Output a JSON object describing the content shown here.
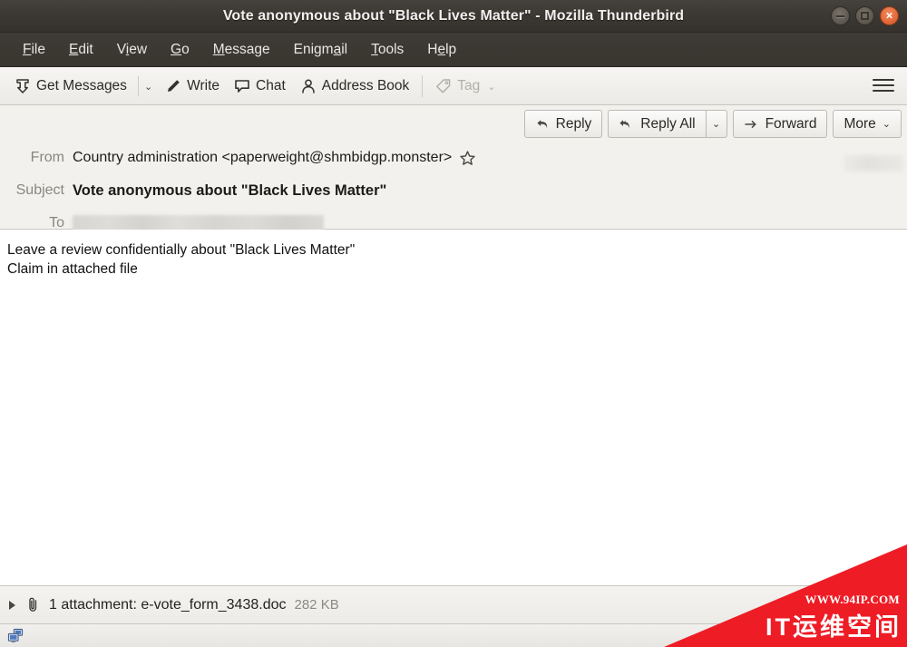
{
  "window": {
    "title": "Vote anonymous about \"Black Lives Matter\" - Mozilla Thunderbird",
    "controls": {
      "minimize": "minimize",
      "maximize": "maximize",
      "close": "×"
    }
  },
  "menubar": {
    "items": [
      {
        "label": "File",
        "accel_index": 0
      },
      {
        "label": "Edit",
        "accel_index": 0
      },
      {
        "label": "View",
        "accel_index": 1
      },
      {
        "label": "Go",
        "accel_index": 0
      },
      {
        "label": "Message",
        "accel_index": 0
      },
      {
        "label": "Enigmail",
        "accel_index": 4
      },
      {
        "label": "Tools",
        "accel_index": 0
      },
      {
        "label": "Help",
        "accel_index": 1
      }
    ]
  },
  "toolbar": {
    "get_messages_label": "Get Messages",
    "get_messages_caret": "⌄",
    "write_label": "Write",
    "chat_label": "Chat",
    "address_book_label": "Address Book",
    "tag_label": "Tag",
    "tag_caret": "⌄",
    "tag_disabled": true,
    "app_menu_label": "Application menu"
  },
  "message_actions": {
    "reply_label": "Reply",
    "reply_all_label": "Reply All",
    "reply_all_caret": "⌄",
    "forward_label": "Forward",
    "more_label": "More",
    "more_caret": "⌄"
  },
  "headers": {
    "from_label": "From",
    "from_value": "Country administration <paperweight@shmbidgp.monster>",
    "subject_label": "Subject",
    "subject_value": "Vote anonymous about \"Black Lives Matter\"",
    "to_label": "To",
    "to_value_redacted": true
  },
  "body": {
    "lines": [
      "Leave a review confidentially about \"Black Lives Matter\"",
      "Claim in attached file"
    ]
  },
  "attachment": {
    "summary": "1 attachment: e-vote_form_3438.doc",
    "size": "282 KB"
  },
  "statusbar": {
    "icon": "network-computers-icon"
  },
  "watermark": {
    "url": "WWW.94IP.COM",
    "brand": "IT运维空间",
    "color": "#ee1c25"
  },
  "colors": {
    "titlebar_bg": "#3b3833",
    "toolbar_bg": "#f1efec",
    "header_bg": "#f2f1ee",
    "body_bg": "#ffffff",
    "text": "#1d1b18",
    "muted": "#8a8781"
  }
}
